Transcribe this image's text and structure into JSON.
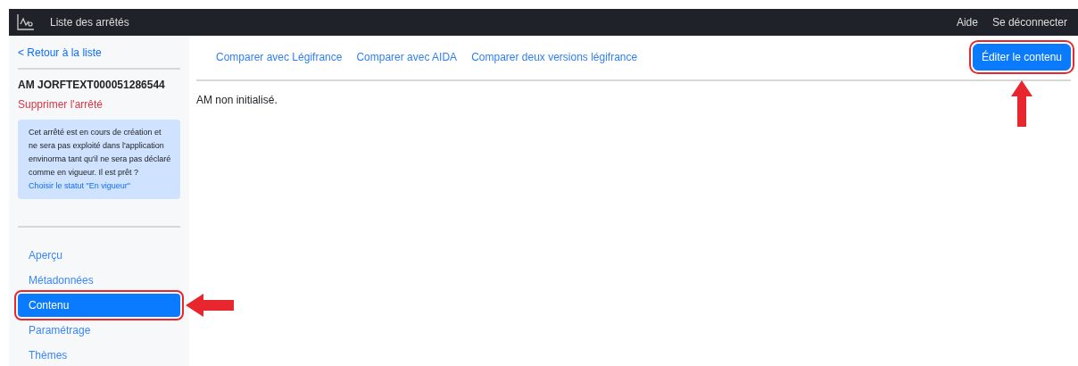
{
  "navbar": {
    "title": "Liste des arrêtés",
    "links": [
      "Aide",
      "Se déconnecter"
    ]
  },
  "sidebar": {
    "back_link": "< Retour à la liste",
    "heading": "AM JORFTEXT000051286544",
    "delete_link": "Supprimer l'arrêté",
    "alert": {
      "text": "Cet arrêté est en cours de création et ne sera pas exploité dans l'application envinorma tant qu'il ne sera pas déclaré comme en vigueur. Il est prêt ?",
      "link": "Choisir le statut \"En vigueur\""
    },
    "items": [
      {
        "label": "Aperçu",
        "selected": false,
        "highlighted": false
      },
      {
        "label": "Métadonnées",
        "selected": false,
        "highlighted": false
      },
      {
        "label": "Contenu",
        "selected": true,
        "highlighted": true
      },
      {
        "label": "Paramétrage",
        "selected": false,
        "highlighted": false
      },
      {
        "label": "Thèmes",
        "selected": false,
        "highlighted": false
      }
    ]
  },
  "main": {
    "links": [
      "Comparer avec Légifrance",
      "Comparer avec AIDA",
      "Comparer deux versions légifrance"
    ],
    "button": {
      "label": "Éditer le contenu",
      "highlighted": true
    },
    "message": "AM non initialisé."
  }
}
